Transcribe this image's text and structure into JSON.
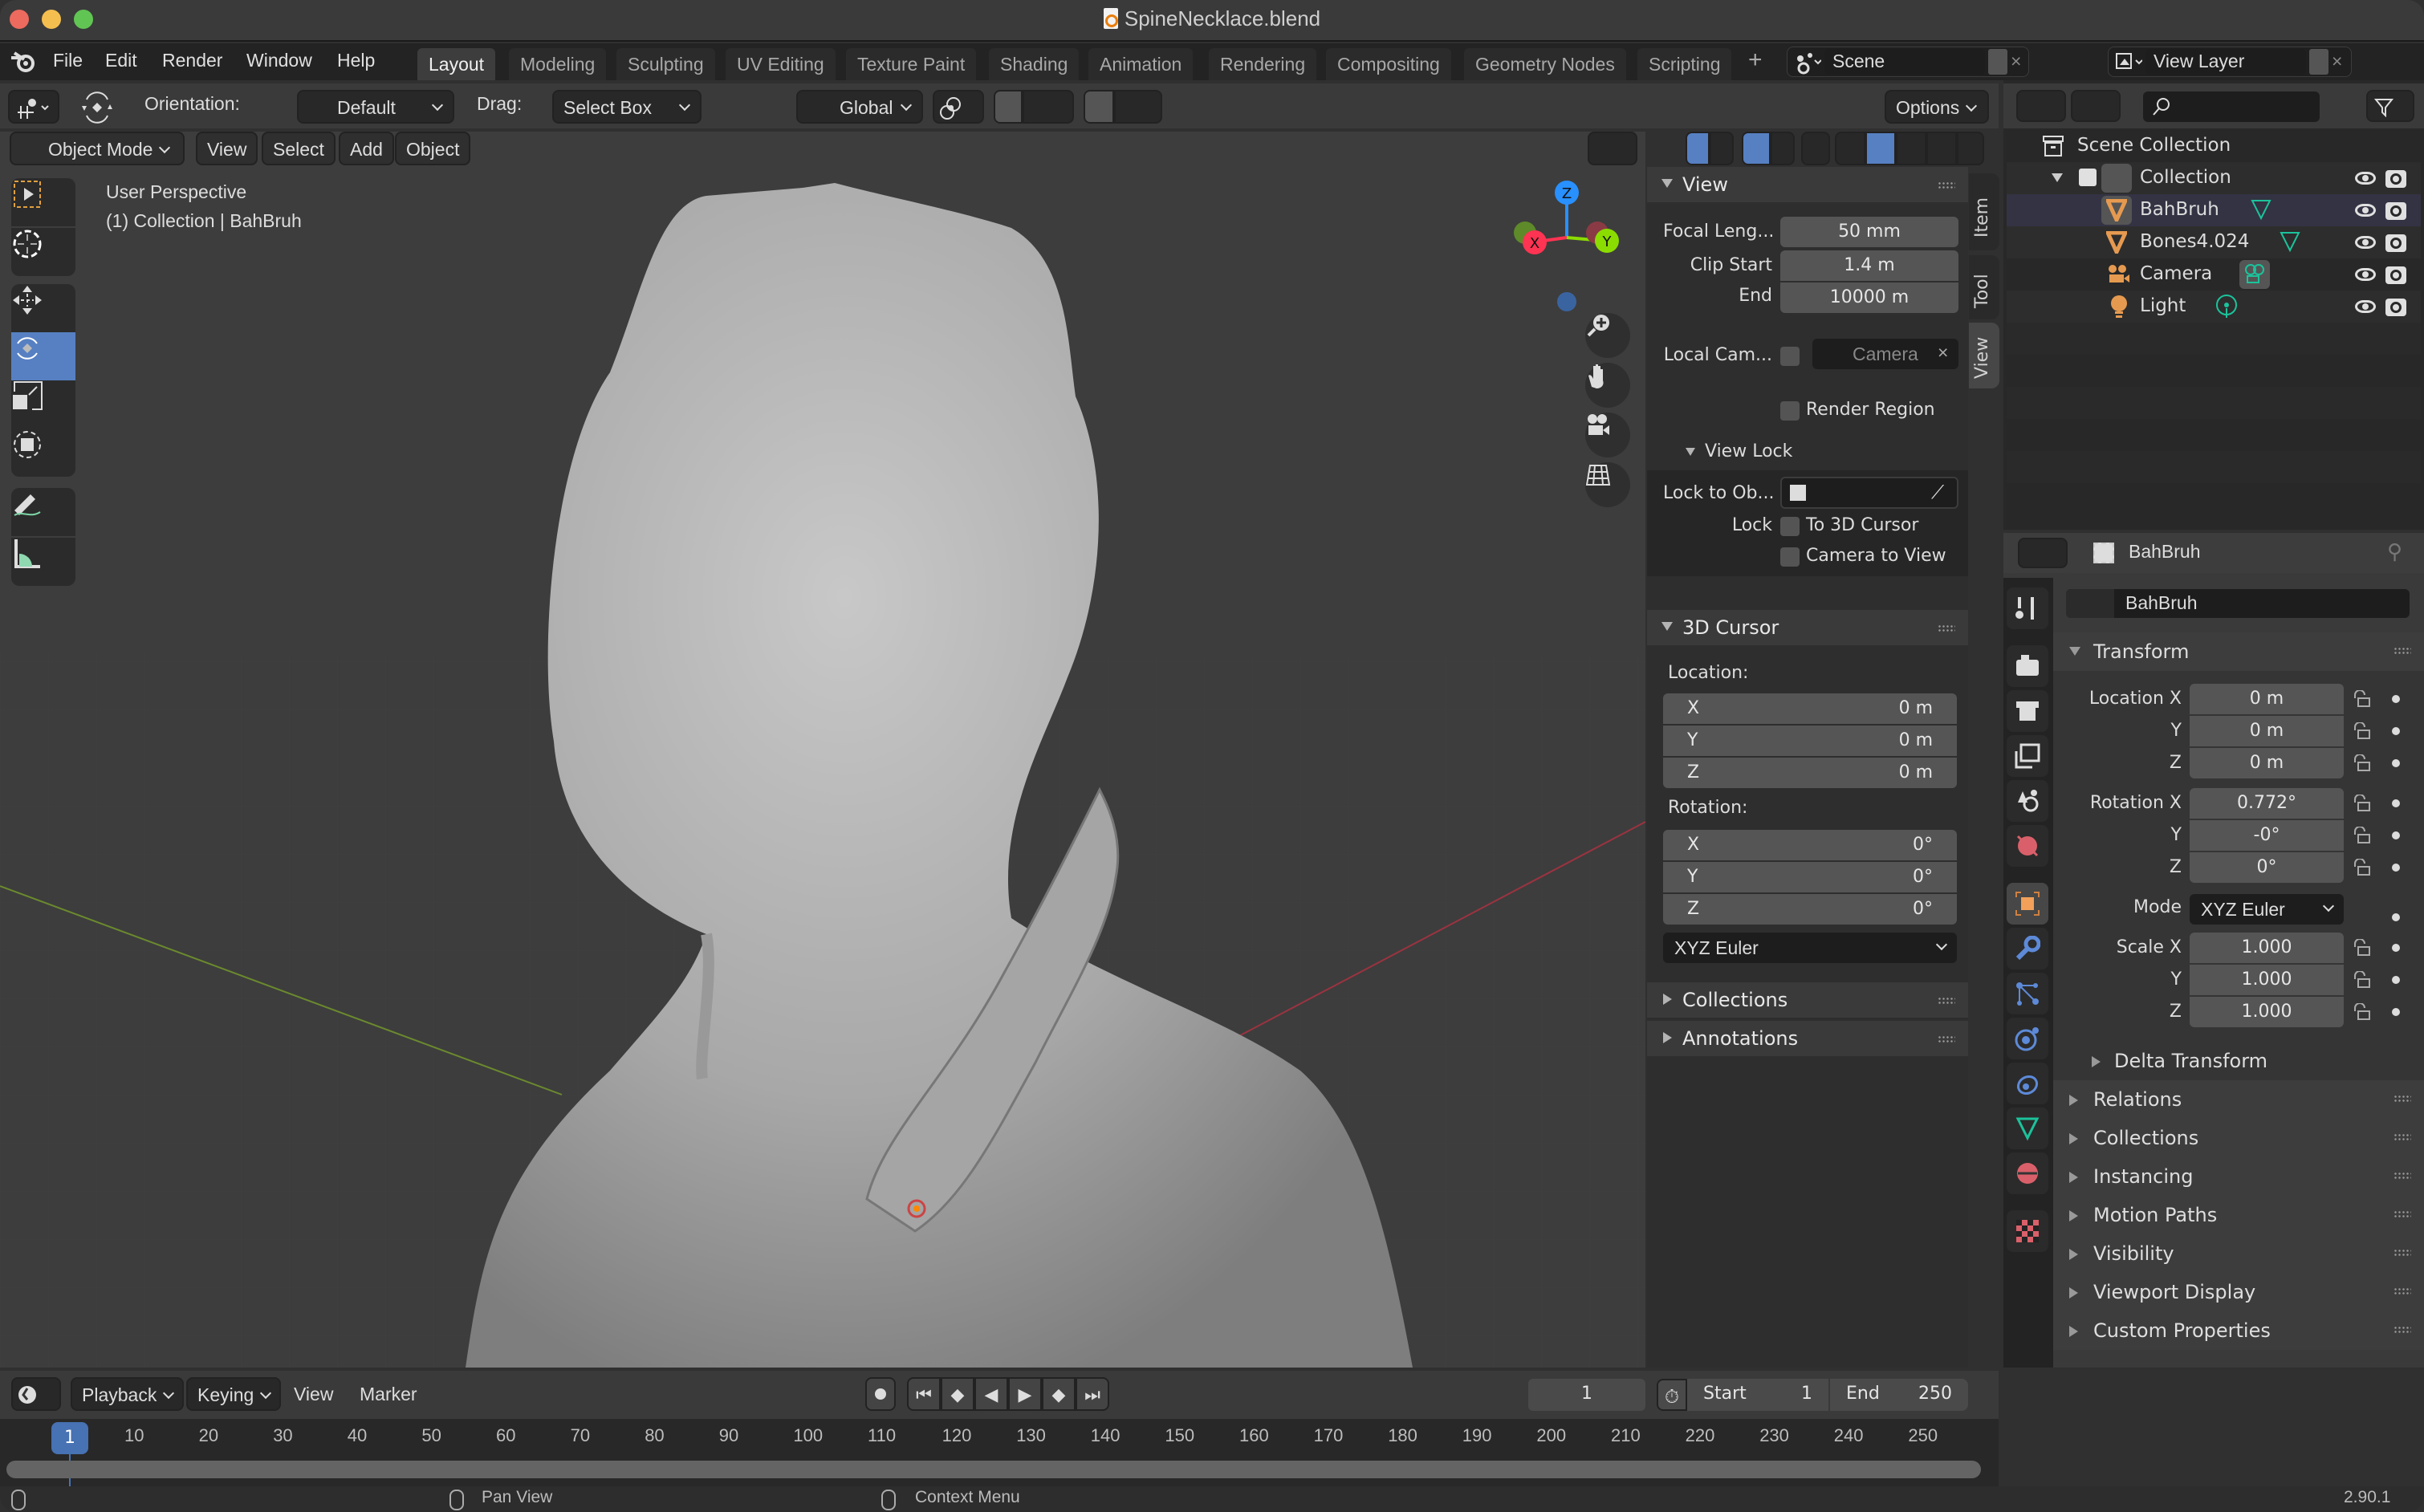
{
  "window": {
    "title": "SpineNecklace.blend",
    "traffic_lights": {
      "close": "#ed6a5e",
      "minimize": "#f5bf4f",
      "maximize": "#61c554"
    }
  },
  "menubar": {
    "app_icon": "blender-logo-icon",
    "menus": [
      "File",
      "Edit",
      "Render",
      "Window",
      "Help"
    ],
    "workspaces": [
      "Layout",
      "Modeling",
      "Sculpting",
      "UV Editing",
      "Texture Paint",
      "Shading",
      "Animation",
      "Rendering",
      "Compositing",
      "Geometry Nodes",
      "Scripting"
    ],
    "active_workspace": "Layout",
    "add_workspace": "+",
    "scene": "Scene",
    "view_layer": "View Layer"
  },
  "tool_header": {
    "orientation_label": "Orientation:",
    "orientation_value": "Default",
    "drag_label": "Drag:",
    "drag_value": "Select Box",
    "transform_orientation": "Global",
    "options": "Options"
  },
  "viewport_header": {
    "mode": "Object Mode",
    "menus": [
      "View",
      "Select",
      "Add",
      "Object"
    ]
  },
  "viewport": {
    "info_line1": "User Perspective",
    "info_line2": "(1) Collection | BahBruh",
    "gizmo_axes": {
      "x": "X",
      "y": "Y",
      "z": "Z"
    },
    "colors": {
      "x": "#ff3352",
      "y": "#8bdc00",
      "z": "#2890ff",
      "active_tool": "#5680c2"
    },
    "tools": [
      "select-box",
      "cursor",
      "move",
      "rotate",
      "scale",
      "transform",
      "annotate",
      "measure"
    ],
    "active_tool": "rotate",
    "nav_buttons": [
      "zoom",
      "pan",
      "camera-view",
      "ortho-toggle"
    ]
  },
  "npanel": {
    "tabs": [
      "Item",
      "Tool",
      "View"
    ],
    "active_tab": "View",
    "view": {
      "title": "View",
      "focal_length_label": "Focal Leng...",
      "focal_length": "50 mm",
      "clip_start_label": "Clip Start",
      "clip_start": "1.4 m",
      "clip_end_label": "End",
      "clip_end": "10000 m",
      "local_camera_label": "Local Cam...",
      "local_camera_value": "Camera",
      "render_region": "Render Region"
    },
    "view_lock": {
      "title": "View Lock",
      "lock_to_object_label": "Lock to Ob...",
      "lock_label": "Lock",
      "to_3d_cursor": "To 3D Cursor",
      "camera_to_view": "Camera to View"
    },
    "cursor": {
      "title": "3D Cursor",
      "location_label": "Location:",
      "location": [
        {
          "axis": "X",
          "value": "0 m"
        },
        {
          "axis": "Y",
          "value": "0 m"
        },
        {
          "axis": "Z",
          "value": "0 m"
        }
      ],
      "rotation_label": "Rotation:",
      "rotation": [
        {
          "axis": "X",
          "value": "0°"
        },
        {
          "axis": "Y",
          "value": "0°"
        },
        {
          "axis": "Z",
          "value": "0°"
        }
      ],
      "rotation_mode": "XYZ Euler"
    },
    "collapsed": [
      "Collections",
      "Annotations"
    ]
  },
  "outliner": {
    "root": "Scene Collection",
    "items": [
      {
        "name": "Collection",
        "type": "collection"
      },
      {
        "name": "BahBruh",
        "type": "mesh",
        "selected": true
      },
      {
        "name": "Bones4.024",
        "type": "mesh"
      },
      {
        "name": "Camera",
        "type": "camera"
      },
      {
        "name": "Light",
        "type": "light"
      }
    ]
  },
  "properties": {
    "context_object": "BahBruh",
    "object_name": "BahBruh",
    "transform": {
      "title": "Transform",
      "location_label": "Location X",
      "location": [
        "0 m",
        "0 m",
        "0 m"
      ],
      "rotation_label": "Rotation X",
      "rotation": [
        "0.772°",
        "-0°",
        "0°"
      ],
      "mode_label": "Mode",
      "mode": "XYZ Euler",
      "scale_label": "Scale X",
      "scale": [
        "1.000",
        "1.000",
        "1.000"
      ],
      "axis_y": "Y",
      "axis_z": "Z"
    },
    "delta_transform": "Delta Transform",
    "sections": [
      "Relations",
      "Collections",
      "Instancing",
      "Motion Paths",
      "Visibility",
      "Viewport Display",
      "Custom Properties"
    ]
  },
  "timeline": {
    "menus": [
      "Playback",
      "Keying",
      "View",
      "Marker"
    ],
    "current_frame": "1",
    "start_label": "Start",
    "start": "1",
    "end_label": "End",
    "end": "250",
    "ticks": [
      "10",
      "20",
      "30",
      "40",
      "50",
      "60",
      "70",
      "80",
      "90",
      "100",
      "110",
      "120",
      "130",
      "140",
      "150",
      "160",
      "170",
      "180",
      "190",
      "200",
      "210",
      "220",
      "230",
      "240",
      "250"
    ],
    "playhead": "1"
  },
  "statusbar": {
    "pan_view": "Pan View",
    "context_menu": "Context Menu",
    "version": "2.90.1"
  }
}
